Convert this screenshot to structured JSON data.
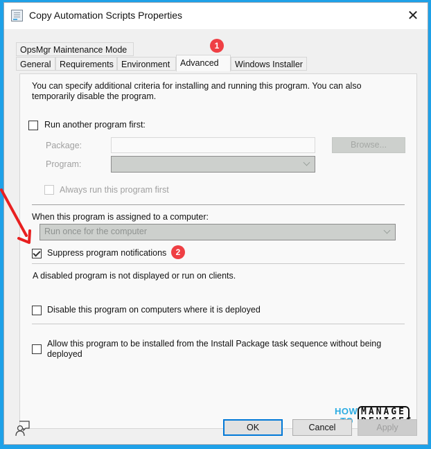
{
  "window": {
    "title": "Copy Automation Scripts Properties",
    "close_icon": "close-icon"
  },
  "tabs": {
    "row_top": [
      {
        "label": "OpsMgr Maintenance Mode"
      }
    ],
    "row_bottom": [
      {
        "label": "General"
      },
      {
        "label": "Requirements"
      },
      {
        "label": "Environment"
      },
      {
        "label": "Advanced",
        "active": true
      },
      {
        "label": "Windows Installer"
      }
    ]
  },
  "advanced": {
    "description": "You can specify additional criteria for installing and running this program. You can also",
    "description_line2": "temporarily disable the program.",
    "run_another_first": {
      "label": "Run another program first:",
      "checked": false
    },
    "package": {
      "label": "Package:",
      "value": ""
    },
    "browse_label": "Browse...",
    "program": {
      "label": "Program:",
      "value": ""
    },
    "always_run_first": {
      "label": "Always run this program first",
      "checked": false
    },
    "assigned_label": "When this program is assigned to a computer:",
    "assigned_value": "Run once for the computer",
    "suppress": {
      "label": "Suppress program notifications",
      "checked": true
    },
    "disabled_note": "A disabled program is not displayed or run on clients.",
    "disable_program": {
      "label": "Disable this program on computers where it is deployed",
      "checked": false
    },
    "allow_install": {
      "label": "Allow this program to be installed from the Install Package task sequence without being",
      "label_line2": "deployed",
      "checked": false
    }
  },
  "annotations": {
    "badge1": "1",
    "badge2": "2",
    "badge_color": "#ef3f44",
    "arrow_color": "#e82020"
  },
  "logo": {
    "how": "HOW",
    "to": "TO",
    "manage": "MANAGE",
    "devices": "DEVICES"
  },
  "footer": {
    "ok_label": "OK",
    "cancel_label": "Cancel",
    "apply_label": "Apply",
    "help_icon": "user-feedback-icon"
  },
  "colors": {
    "frame": "#1ea1e8",
    "default_button_border": "#0078d7"
  }
}
